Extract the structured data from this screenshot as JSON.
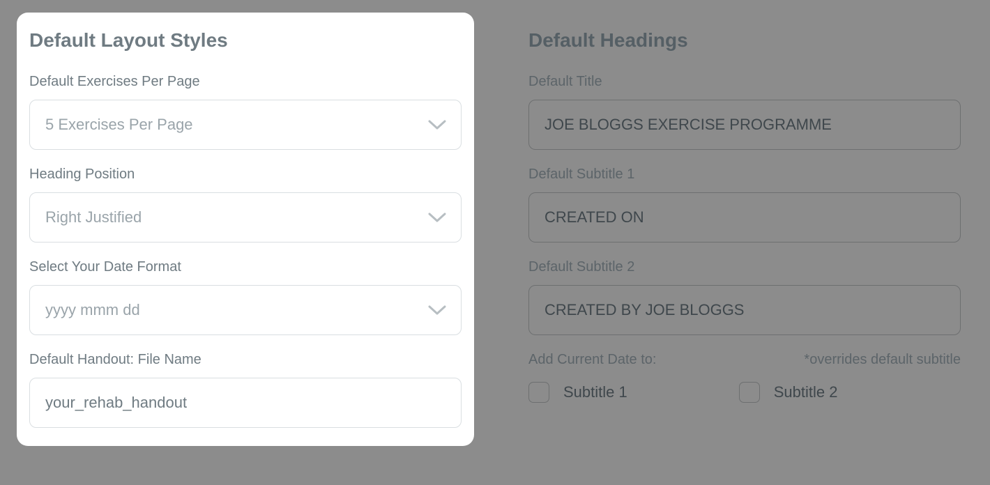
{
  "left_panel": {
    "title": "Default Layout Styles",
    "exercises_label": "Default Exercises Per Page",
    "exercises_value": "5 Exercises Per Page",
    "heading_position_label": "Heading Position",
    "heading_position_value": "Right Justified",
    "date_format_label": "Select Your Date Format",
    "date_format_value": "yyyy mmm dd",
    "handout_label": "Default Handout: File Name",
    "handout_value": "your_rehab_handout"
  },
  "right_panel": {
    "title": "Default Headings",
    "default_title_label": "Default Title",
    "default_title_value": "JOE BLOGGS EXERCISE PROGRAMME",
    "subtitle1_label": "Default Subtitle 1",
    "subtitle1_value": "CREATED ON",
    "subtitle2_label": "Default Subtitle 2",
    "subtitle2_value": "CREATED BY JOE BLOGGS",
    "add_date_label": "Add Current Date to:",
    "overrides_note": "*overrides default subtitle",
    "checkbox1_label": "Subtitle 1",
    "checkbox2_label": "Subtitle 2"
  }
}
